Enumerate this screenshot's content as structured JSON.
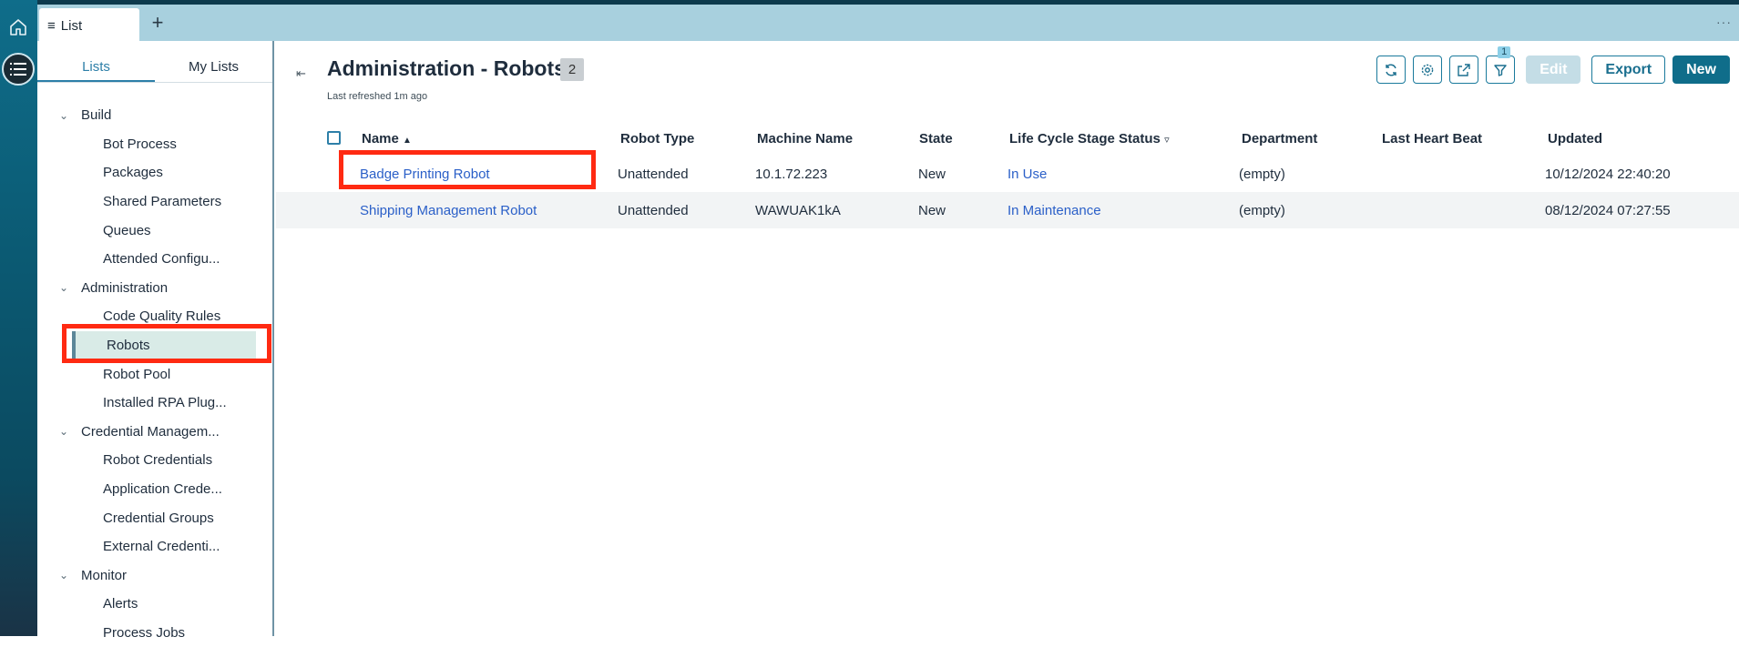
{
  "tab": {
    "label": "List",
    "menu_glyph": "≡"
  },
  "sidebar": {
    "tabs": [
      {
        "label": "Lists"
      },
      {
        "label": "My Lists"
      }
    ],
    "tree": [
      {
        "type": "group",
        "label": "Build"
      },
      {
        "type": "item",
        "label": "Bot Process"
      },
      {
        "type": "item",
        "label": "Packages"
      },
      {
        "type": "item",
        "label": "Shared Parameters"
      },
      {
        "type": "item",
        "label": "Queues"
      },
      {
        "type": "item",
        "label": "Attended Configu..."
      },
      {
        "type": "group",
        "label": "Administration"
      },
      {
        "type": "item",
        "label": "Code Quality Rules"
      },
      {
        "type": "item",
        "label": "Robots",
        "selected": true
      },
      {
        "type": "item",
        "label": "Robot Pool"
      },
      {
        "type": "item",
        "label": "Installed RPA Plug..."
      },
      {
        "type": "group",
        "label": "Credential Managem..."
      },
      {
        "type": "item",
        "label": "Robot Credentials"
      },
      {
        "type": "item",
        "label": "Application Crede..."
      },
      {
        "type": "item",
        "label": "Credential Groups"
      },
      {
        "type": "item",
        "label": "External Credenti..."
      },
      {
        "type": "group",
        "label": "Monitor"
      },
      {
        "type": "item",
        "label": "Alerts"
      },
      {
        "type": "item",
        "label": "Process Jobs"
      }
    ]
  },
  "main": {
    "title": "Administration - Robots",
    "count": "2",
    "last_refreshed": "Last refreshed 1m ago",
    "toolbar": {
      "filter_count": "1",
      "edit": "Edit",
      "export": "Export",
      "new": "New"
    },
    "columns": {
      "name": "Name",
      "robot_type": "Robot Type",
      "machine_name": "Machine Name",
      "state": "State",
      "lifecycle": "Life Cycle Stage Status",
      "department": "Department",
      "last_heart_beat": "Last Heart Beat",
      "updated": "Updated"
    },
    "rows": [
      {
        "name": "Badge Printing Robot",
        "robot_type": "Unattended",
        "machine_name": "10.1.72.223",
        "state": "New",
        "lifecycle": "In Use",
        "department": "(empty)",
        "last_heart_beat": "",
        "updated": "10/12/2024 22:40:20"
      },
      {
        "name": "Shipping Management Robot",
        "robot_type": "Unattended",
        "machine_name": "WAWUAK1kA",
        "state": "New",
        "lifecycle": "In Maintenance",
        "department": "(empty)",
        "last_heart_beat": "",
        "updated": "08/12/2024 07:27:55"
      }
    ]
  },
  "colors": {
    "accent": "#0f6d8a",
    "link": "#2a5fc8",
    "highlight": "#ff2a12",
    "tabbar": "#a8d0de"
  }
}
